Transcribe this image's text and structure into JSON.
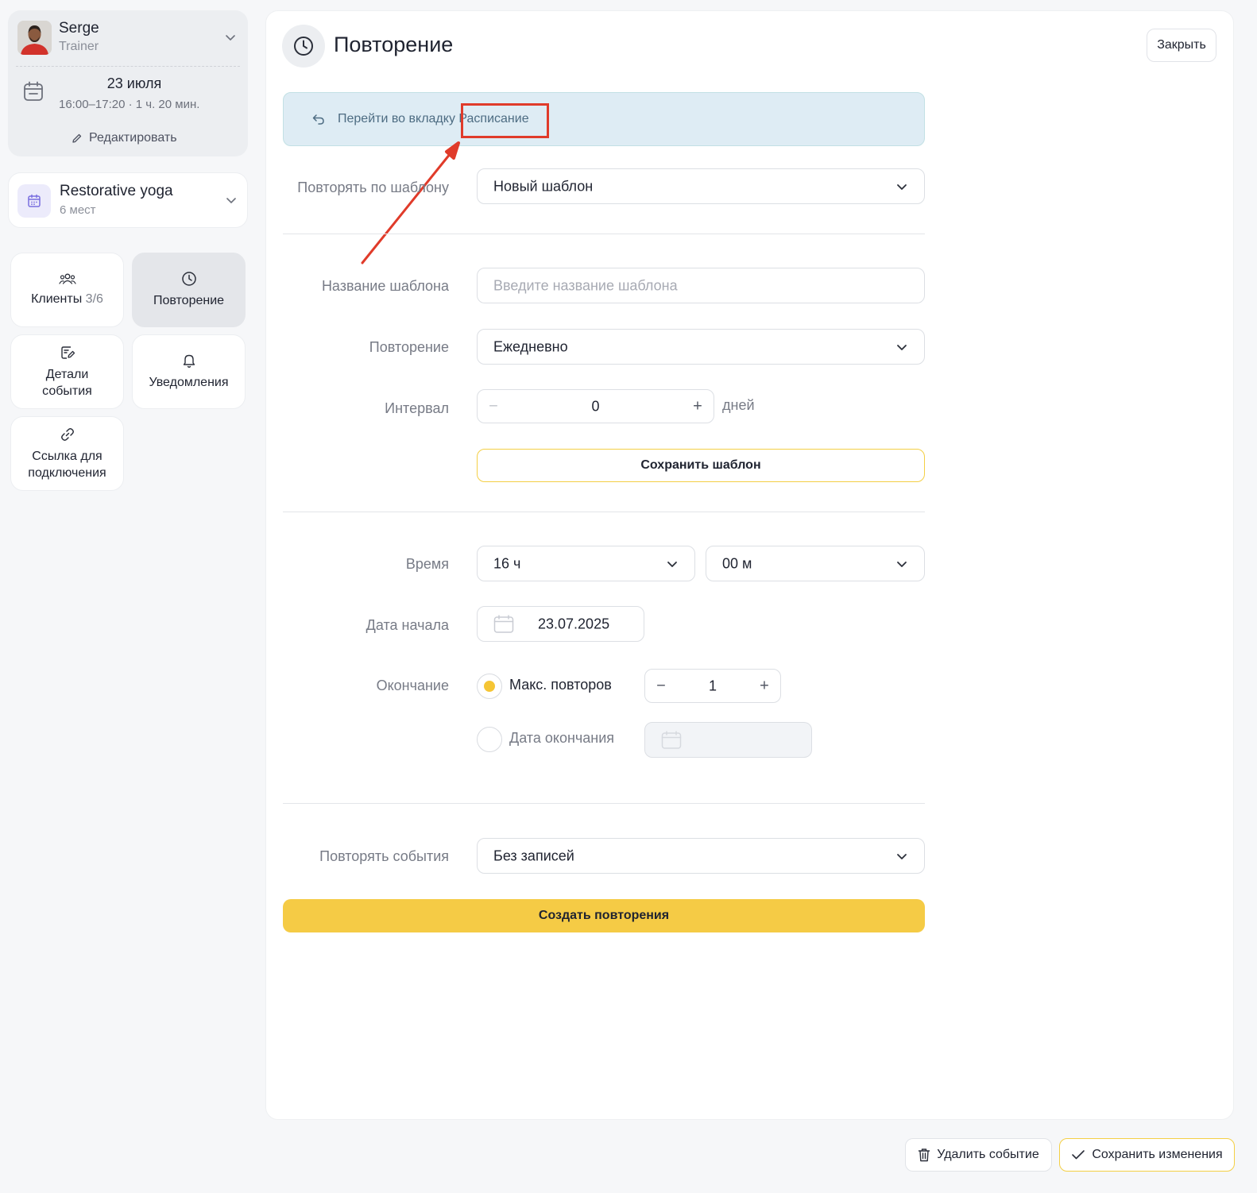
{
  "trainer": {
    "name": "Serge",
    "role": "Trainer"
  },
  "session": {
    "date": "23 июля",
    "time": "16:00–17:20 · 1 ч. 20 мин.",
    "edit_label": "Редактировать"
  },
  "class": {
    "name": "Restorative yoga",
    "seats": "6 мест"
  },
  "tiles": [
    {
      "label": "Клиенты",
      "count": "3/6",
      "icon": "clients-icon"
    },
    {
      "label": "Повторение",
      "icon": "clock-icon",
      "active": true
    },
    {
      "label": "Детали события",
      "icon": "edit-details-icon"
    },
    {
      "label": "Уведомления",
      "icon": "bell-icon"
    },
    {
      "label": "Ссылка для подключения",
      "icon": "link-icon"
    }
  ],
  "header": {
    "title": "Повторение",
    "close_label": "Закрыть"
  },
  "notice": {
    "prefix": "Перейти во вкладку",
    "link": "Расписание"
  },
  "form": {
    "template_label": "Повторять по шаблону",
    "template_value": "Новый шаблон",
    "template_name_label": "Название шаблона",
    "template_name_placeholder": "Введите название шаблона",
    "repeat_label": "Повторение",
    "repeat_value": "Ежедневно",
    "interval_label": "Интервал",
    "interval_value": "0",
    "interval_unit": "дней",
    "save_template_label": "Сохранить шаблон",
    "time_label": "Время",
    "time_hours": "16 ч",
    "time_minutes": "00 м",
    "start_date_label": "Дата начала",
    "start_date_value": "23.07.2025",
    "ending_label": "Окончание",
    "max_repeats_label": "Макс. повторов",
    "max_repeats_value": "1",
    "end_date_label": "Дата окончания",
    "repeat_events_label": "Повторять события",
    "repeat_events_value": "Без записей",
    "create_label": "Создать повторения"
  },
  "footer": {
    "delete_label": "Удалить событие",
    "save_label": "Сохранить изменения"
  },
  "colors": {
    "accent": "#f5cb45",
    "annotation": "#e03b2a",
    "notice_bg": "#deecf4"
  }
}
